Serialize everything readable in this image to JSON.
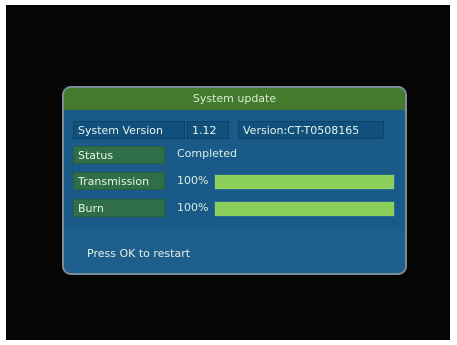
{
  "dialog": {
    "title": "System update",
    "version_label": "System Version",
    "version_value": "1.12",
    "version_detail": "Version:CT-T0508165",
    "status_label": "Status",
    "status_value": "Completed",
    "transmission_label": "Transmission",
    "transmission_percent": "100%",
    "transmission_progress": 1.0,
    "burn_label": "Burn",
    "burn_percent": "100%",
    "burn_progress": 1.0,
    "footer_message": "Press OK to restart"
  },
  "colors": {
    "screen_background": "#050505",
    "panel_blue": "#1a5a88",
    "title_green": "#437a2d",
    "progress_green": "#8ad05a"
  }
}
